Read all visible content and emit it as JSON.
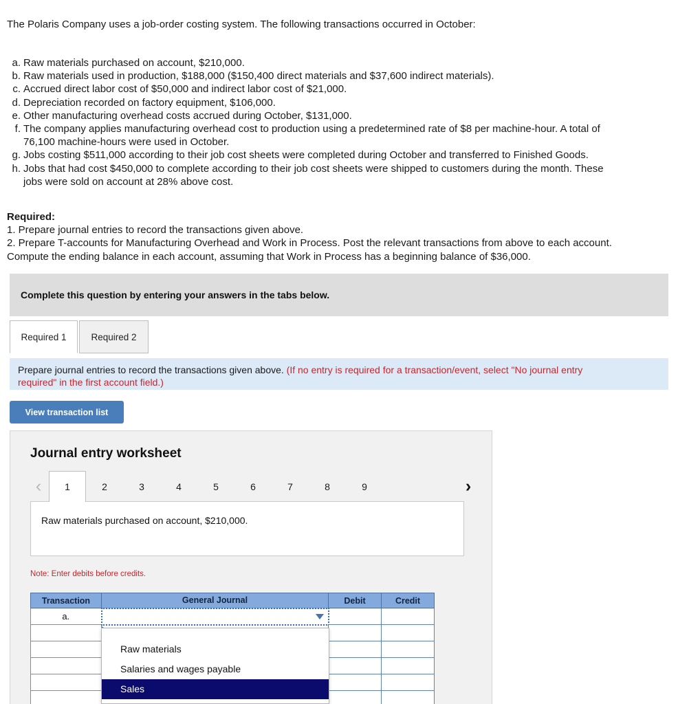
{
  "problem": {
    "intro": "The Polaris Company uses a job-order costing system. The following transactions occurred in October:",
    "transactions": [
      {
        "label": "a.",
        "text": "Raw materials purchased on account, $210,000.",
        "cont": ""
      },
      {
        "label": "b.",
        "text": "Raw materials used in production, $188,000 ($150,400 direct materials and $37,600 indirect materials).",
        "cont": ""
      },
      {
        "label": "c.",
        "text": "Accrued direct labor cost of $50,000 and indirect labor cost of $21,000.",
        "cont": ""
      },
      {
        "label": "d.",
        "text": "Depreciation recorded on factory equipment, $106,000.",
        "cont": ""
      },
      {
        "label": "e.",
        "text": "Other manufacturing overhead costs accrued during October, $131,000.",
        "cont": ""
      },
      {
        "label": "f.",
        "text": "The company applies manufacturing overhead cost to production using a predetermined rate of $8 per machine-hour. A total of",
        "cont": "76,100 machine-hours were used in October."
      },
      {
        "label": "g.",
        "text": "Jobs costing $511,000 according to their job cost sheets were completed during October and transferred to Finished Goods.",
        "cont": ""
      },
      {
        "label": "h.",
        "text": "Jobs that had cost $450,000 to complete according to their job cost sheets were shipped to customers during the month. These",
        "cont": "jobs were sold on account at 28% above cost."
      }
    ],
    "required_heading": "Required:",
    "required_lines": [
      "1. Prepare journal entries to record the transactions given above.",
      "2. Prepare T-accounts for Manufacturing Overhead and Work in Process. Post the relevant transactions from above to each account.",
      "Compute the ending balance in each account, assuming that Work in Process has a beginning balance of $36,000."
    ]
  },
  "complete_banner": {
    "text": "Complete this question by entering your answers in the tabs below."
  },
  "tabs": [
    {
      "label": "Required 1",
      "active": true
    },
    {
      "label": "Required 2",
      "active": false
    }
  ],
  "instruction": {
    "black_text": "Prepare journal entries to record the transactions given above.",
    "red_text": "(If no entry is required for a transaction/event, select \"No journal entry",
    "red_text_line2": "required\" in the first account field.)"
  },
  "view_transaction_button": {
    "label": "View transaction list"
  },
  "worksheet": {
    "title": "Journal entry worksheet",
    "pager": {
      "prev_icon": "chevron-left",
      "next_icon": "chevron-right",
      "pages": [
        "1",
        "2",
        "3",
        "4",
        "5",
        "6",
        "7",
        "8",
        "9"
      ],
      "active_page": "1"
    },
    "description": "Raw materials purchased on account, $210,000.",
    "note": "Note: Enter debits before credits.",
    "table": {
      "headers": [
        "Transaction",
        "General Journal",
        "Debit",
        "Credit"
      ],
      "rows": [
        {
          "transaction": "a.",
          "general_journal": "",
          "debit": "",
          "credit": "",
          "active": true
        },
        {
          "transaction": "",
          "general_journal": "",
          "debit": "",
          "credit": "",
          "active": false
        },
        {
          "transaction": "",
          "general_journal": "",
          "debit": "",
          "credit": "",
          "active": false
        },
        {
          "transaction": "",
          "general_journal": "",
          "debit": "",
          "credit": "",
          "active": false
        },
        {
          "transaction": "",
          "general_journal": "",
          "debit": "",
          "credit": "",
          "active": false
        },
        {
          "transaction": "",
          "general_journal": "",
          "debit": "",
          "credit": "",
          "active": false
        }
      ]
    },
    "dropdown": {
      "options": [
        {
          "label": "Raw materials",
          "selected": false
        },
        {
          "label": "Salaries and wages payable",
          "selected": false
        },
        {
          "label": "Sales",
          "selected": true
        }
      ]
    }
  },
  "colors": {
    "header_blue": "#84a9dc",
    "button_blue": "#4a7ebb",
    "banner_gray": "#dddddd",
    "instruction_blue": "#dce9f7",
    "red_note": "#c8252c",
    "dropdown_selected": "#0b0b6e"
  }
}
